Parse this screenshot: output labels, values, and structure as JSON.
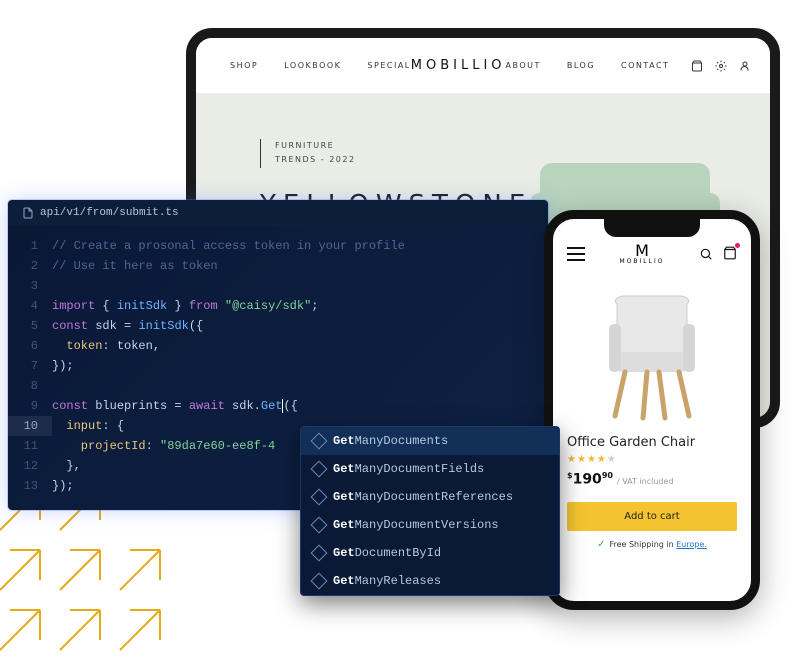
{
  "tablet": {
    "nav_left": [
      "SHOP",
      "LOOKBOOK",
      "SPECIAL"
    ],
    "brand": "MOBILLIO",
    "nav_right": [
      "ABOUT",
      "BLOG",
      "CONTACT"
    ],
    "hero_tag_line1": "FURNITURE",
    "hero_tag_line2": "TRENDS - 2022",
    "hero_title": "YELLOWSTONE"
  },
  "phone": {
    "brand_initial": "M",
    "brand_name": "MOBILLIO",
    "product_name": "Office Garden Chair",
    "currency": "$",
    "price_int": "190",
    "price_dec": "90",
    "vat": "/ VAT included",
    "cta": "Add to cart",
    "ship_prefix": "Free Shipping in ",
    "ship_link": "Europe."
  },
  "editor": {
    "filename": "api/v1/from/submit.ts",
    "lines": {
      "l1": "// Create a prosonal access token in your profile",
      "l2": "// Use it here as token",
      "l4_import": "import",
      "l4_brace_open": " { ",
      "l4_initSdk": "initSdk",
      "l4_brace_close": " } ",
      "l4_from": "from",
      "l4_pkg": " \"@caisy/sdk\"",
      "l4_semi": ";",
      "l5_const": "const",
      "l5_sdk": " sdk = ",
      "l5_call": "initSdk",
      "l5_open": "({",
      "l6_token_key": "  token",
      "l6_token_val": ": token,",
      "l7_close": "});",
      "l9_const": "const",
      "l9_bp": " blueprints = ",
      "l9_await": "await",
      "l9_sdk": " sdk.",
      "l9_get": "Get",
      "l9_open": "({",
      "l10_input": "  input",
      "l10_colon": ": {",
      "l11_pid_key": "    projectId",
      "l11_pid_val": ": ",
      "l11_pid_str": "\"89da7e60-ee8f-4",
      "l12_close": "  },",
      "l13_close": "});"
    },
    "line_nums": [
      "1",
      "2",
      "3",
      "4",
      "5",
      "6",
      "7",
      "8",
      "9",
      "10",
      "11",
      "12",
      "13"
    ]
  },
  "autocomplete": {
    "items": [
      {
        "prefix": "Get",
        "rest": "ManyDocuments"
      },
      {
        "prefix": "Get",
        "rest": "ManyDocumentFields"
      },
      {
        "prefix": "Get",
        "rest": "ManyDocumentReferences"
      },
      {
        "prefix": "Get",
        "rest": "ManyDocumentVersions"
      },
      {
        "prefix": "Get",
        "rest": "DocumentById"
      },
      {
        "prefix": "Get",
        "rest": "ManyReleases"
      }
    ]
  }
}
